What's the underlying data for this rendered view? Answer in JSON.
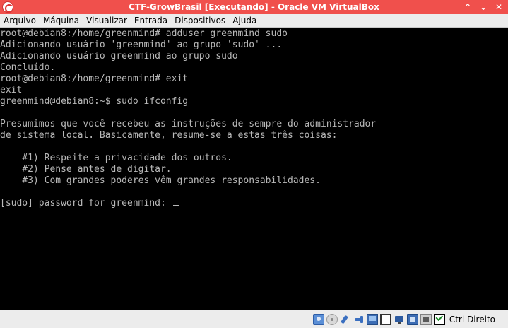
{
  "window": {
    "title": "CTF-GrowBrasil [Executando] - Oracle VM VirtualBox",
    "controls": {
      "restore": "⌃",
      "minimize": "⌄",
      "close": "✕"
    }
  },
  "menu": [
    {
      "label": "Arquivo"
    },
    {
      "label": "Máquina"
    },
    {
      "label": "Visualizar"
    },
    {
      "label": "Entrada"
    },
    {
      "label": "Dispositivos"
    },
    {
      "label": "Ajuda"
    }
  ],
  "terminal": {
    "lines": [
      "root@debian8:/home/greenmind# adduser greenmind sudo",
      "Adicionando usuário 'greenmind' ao grupo 'sudo' ...",
      "Adicionando usuário greenmind ao grupo sudo",
      "Concluído.",
      "root@debian8:/home/greenmind# exit",
      "exit",
      "greenmind@debian8:~$ sudo ifconfig",
      "",
      "Presumimos que você recebeu as instruções de sempre do administrador",
      "de sistema local. Basicamente, resume-se a estas três coisas:",
      "",
      "    #1) Respeite a privacidade dos outros.",
      "    #2) Pense antes de digitar.",
      "    #3) Com grandes poderes vêm grandes responsabilidades.",
      "",
      "[sudo] password for greenmind: "
    ],
    "text_color": "#b8b8b8",
    "background": "#000000"
  },
  "statusbar": {
    "host_key": "Ctrl Direito",
    "icons": [
      "hard-disk-icon",
      "optical-drive-icon",
      "audio-icon",
      "usb-icon",
      "shared-folder-icon",
      "display-icon",
      "network-icon",
      "video-capture-icon",
      "cpu-icon",
      "mouse-integration-icon"
    ]
  },
  "colors": {
    "titlebar": "#f0504c",
    "menubar": "#ececec"
  }
}
